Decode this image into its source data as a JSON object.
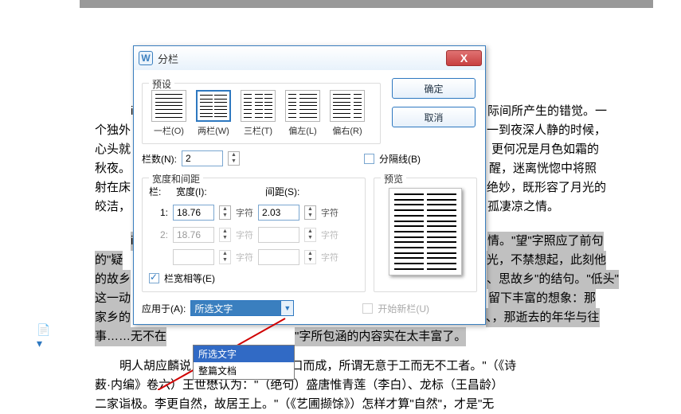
{
  "dialog": {
    "title": "分栏",
    "icon_letter": "W",
    "close": "X",
    "ok": "确定",
    "cancel": "取消",
    "preset_label": "预设",
    "presets": [
      {
        "label": "一栏(O)"
      },
      {
        "label": "两栏(W)"
      },
      {
        "label": "三栏(T)"
      },
      {
        "label": "偏左(L)"
      },
      {
        "label": "偏右(R)"
      }
    ],
    "cols_label": "栏数(N):",
    "cols_value": "2",
    "divider_label": "分隔线(B)",
    "width_spacing_label": "宽度和间距",
    "col_header": "栏:",
    "width_header": "宽度(I):",
    "spacing_header": "间距(S):",
    "row1": {
      "idx": "1:",
      "width": "18.76",
      "spacing": "2.03"
    },
    "row2": {
      "idx": "2:",
      "width": "18.76",
      "spacing": ""
    },
    "row3": {
      "idx": "",
      "width": "",
      "spacing": ""
    },
    "unit": "字符",
    "equal_label": "栏宽相等(E)",
    "preview_label": "预览",
    "apply_label": "应用于(A):",
    "apply_value": "所选文字",
    "startnew_label": "开始新栏(U)",
    "dropdown": [
      "所选文字",
      "整篇文档"
    ]
  },
  "bg": {
    "l1a": "i",
    "l1b": "际间所产生的错觉。一",
    "l2a": "个独外",
    "l2b": "一到夜深人静的时候，",
    "l3a": "心头就",
    "l3b": "更何况是月色如霜的",
    "l4a": "秋夜。",
    "l4b": "醒，迷离恍惚中将照",
    "l5a": "射在床",
    "l5b": "绝妙，既形容了月光的",
    "l6a": "皎洁，",
    "l6b": "孤凄凉之情。",
    "l7a": "i",
    "l7b": "情。\"望\"字照应了前句",
    "l8a": "的\"疑",
    "l8b": "光，不禁想起，此刻他",
    "l9a": "的故乡",
    "l9b": "、思故乡\"的结句。\"低头\"",
    "l10a": "这一动",
    "l10b": "留下丰富的想象：那",
    "l11a": "家乡的",
    "l11b": "、，那逝去的年华与往",
    "l12a": "事……无不在",
    "l12b": "\"字所包涵的内容实在太丰富了。",
    "p2l1": "明人胡应麟说：\"太白诸绝句，信口而成，所谓无意于工而无不工者。\"（《诗",
    "p2l2": "薮·内编》卷六）王世懋认为：\"（绝句）盛唐惟青莲（李白）、龙标（王昌龄）",
    "p2l3": "二家诣极。李更自然，故居王上。\"（《艺圃撷馀》）怎样才算\"自然\"，才是\"无"
  }
}
